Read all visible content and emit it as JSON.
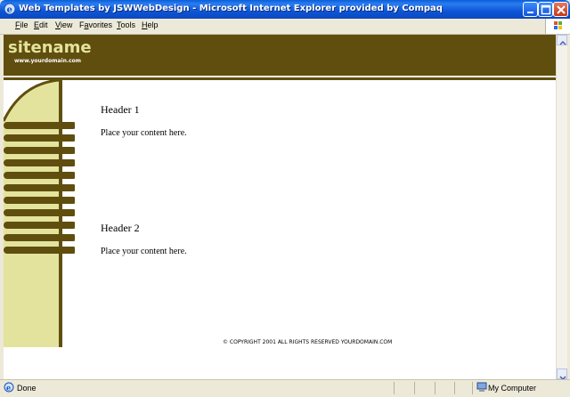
{
  "window": {
    "title": "Web Templates by JSWWebDesign - Microsoft Internet Explorer provided by Compaq",
    "icon": "ie-icon",
    "buttons": [
      "minimize-icon",
      "maximize-icon",
      "close-icon"
    ]
  },
  "menu": {
    "items": [
      {
        "u": "F",
        "rest": "ile"
      },
      {
        "u": "E",
        "rest": "dit"
      },
      {
        "u": "V",
        "rest": "iew"
      },
      {
        "u": "",
        "pre": "F",
        "u2": "a",
        "rest": "vorites"
      },
      {
        "u": "T",
        "rest": "ools"
      },
      {
        "u": "H",
        "rest": "elp"
      }
    ]
  },
  "page": {
    "brand": "sitename",
    "brand_sub": "www.yourdomain.com",
    "sections": [
      {
        "header": "Header 1",
        "body": "Place your content here."
      },
      {
        "header": "Header 2",
        "body": "Place your content here."
      }
    ],
    "footer": "© COPYRIGHT 2001 ALL RIGHTS RESERVED YOURDOMAIN.COM",
    "colors": {
      "olive": "#604e0f",
      "light": "#e3e39e"
    }
  },
  "status": {
    "text": "Done",
    "zone": "My Computer"
  }
}
